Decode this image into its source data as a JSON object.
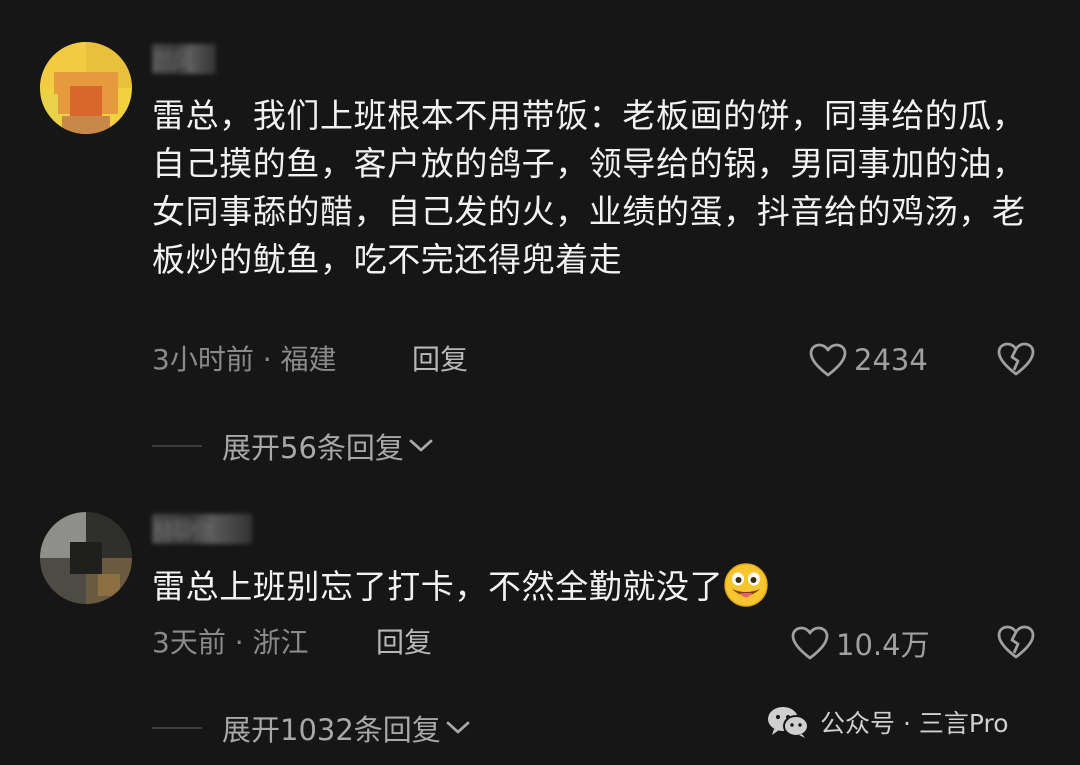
{
  "comments": [
    {
      "username": "颜风",
      "text": "雷总，我们上班根本不用带饭：老板画的饼，同事给的瓜，自己摸的鱼，客户放的鸽子，领导给的锅，男同事加的油，女同事舔的醋，自己发的火，业绩的蛋，抖音给的鸡汤，老板炒的鱿鱼，吃不完还得兜着走",
      "time_location": "3小时前 · 福建",
      "reply_label": "回复",
      "likes": "2434",
      "expand_label": "展开56条回复"
    },
    {
      "username": "赫聊你",
      "text": "雷总上班别忘了打卡，不然全勤就没了",
      "emoji": "grinning-tongue-emoji",
      "time_location": "3天前 · 浙江",
      "reply_label": "回复",
      "likes": "10.4万",
      "expand_label": "展开1032条回复"
    }
  ],
  "watermark": {
    "text": "公众号 · 三言Pro",
    "icon": "wechat-icon"
  },
  "colors": {
    "background": "#161616",
    "text": "#f2f2f2",
    "muted": "#8a8a8a",
    "emoji": "#f7c62f"
  }
}
